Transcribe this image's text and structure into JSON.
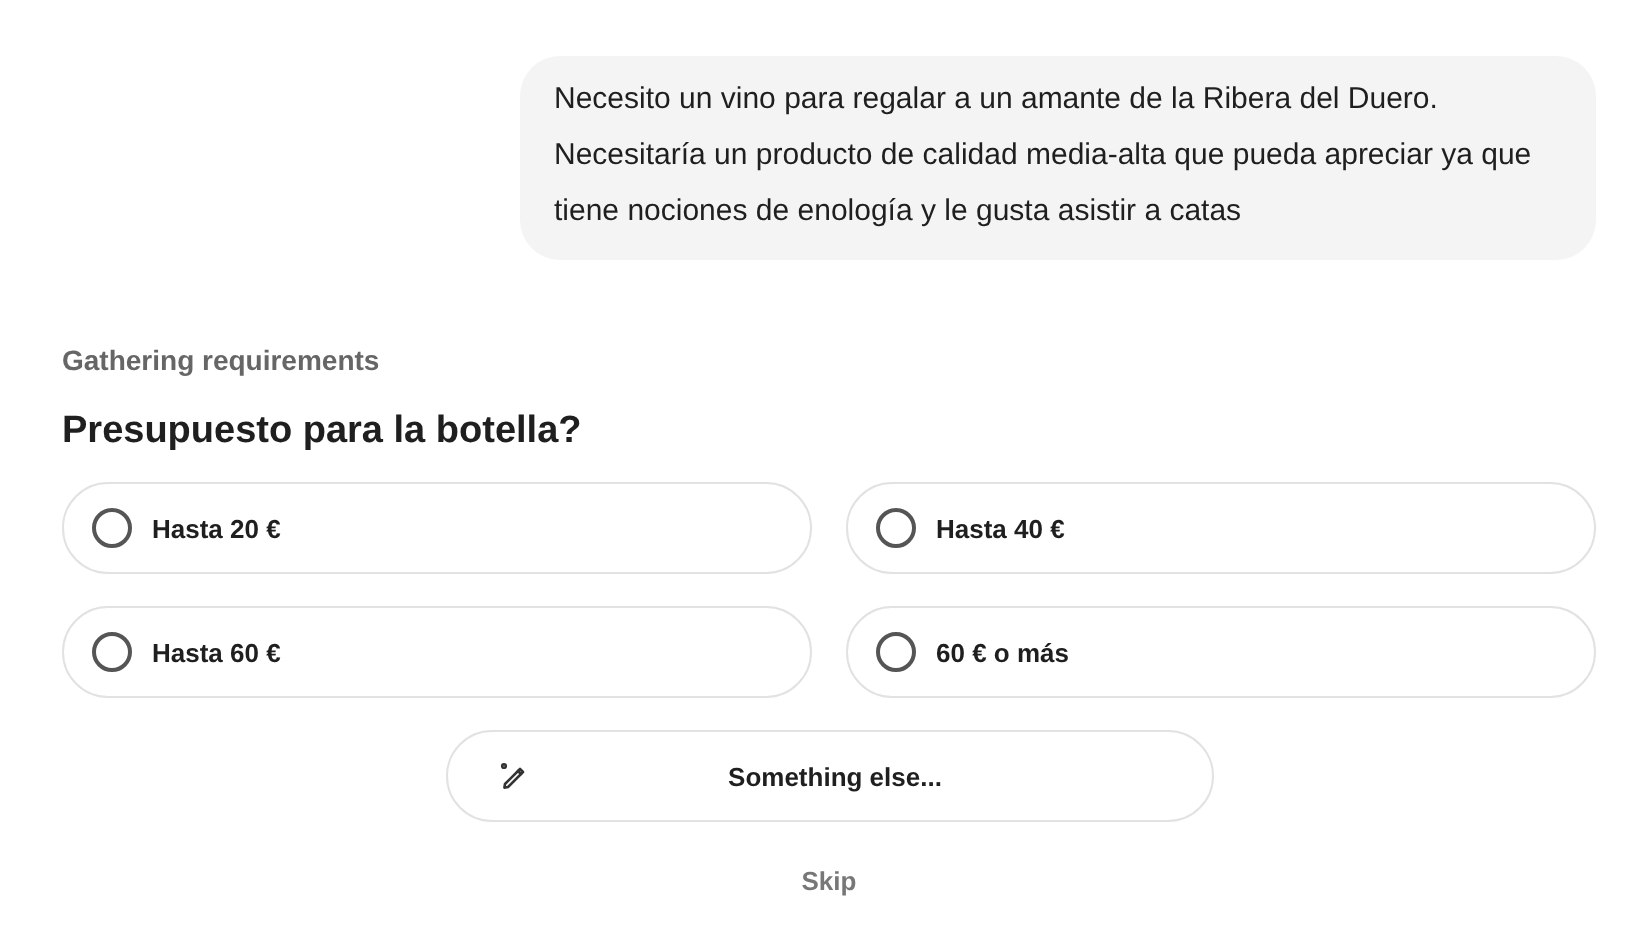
{
  "message": {
    "text": "Necesito un vino para regalar a un amante de la Ribera del Duero. Necesitaría un producto de calidad media-alta que pueda apreciar ya que tiene nociones de enología y le gusta asistir a catas"
  },
  "status": "Gathering requirements",
  "question": "Presupuesto para la botella?",
  "options": [
    {
      "label": "Hasta 20 €",
      "selected": false
    },
    {
      "label": "Hasta 40 €",
      "selected": false
    },
    {
      "label": "Hasta 60 €",
      "selected": false
    },
    {
      "label": "60 € o más",
      "selected": false
    }
  ],
  "other_button": "Something else...",
  "skip": "Skip"
}
